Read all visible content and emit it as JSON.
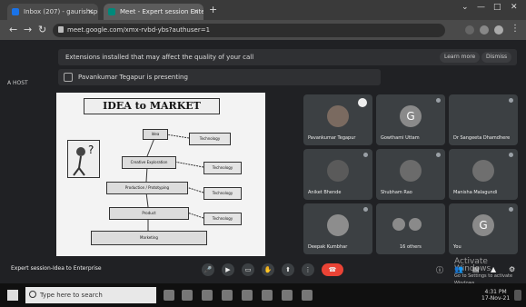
{
  "browser": {
    "tabs": [
      {
        "label": "Inbox (207) - gaurishsp@gmail.com"
      },
      {
        "label": "Meet - Expert session Enter"
      }
    ],
    "url": "meet.google.com/xmx-rvbd-ybs?authuser=1"
  },
  "meet": {
    "notice": "Extensions installed that may affect the quality of your call",
    "notice_learn_more": "Learn more",
    "notice_dismiss": "Dismiss",
    "host_label": "A HOST",
    "presenting_text": "Pavankumar Tegapur is presenting",
    "slide": {
      "title": "IDEA to MARKET",
      "idea": "Idea",
      "creative": "Creative Exploration",
      "production": "Production / Prototyping",
      "product": "Product",
      "marketing": "Marketing",
      "technology": "Technology"
    },
    "participants": [
      {
        "name": "Pavankumar Tegapur",
        "initial": ""
      },
      {
        "name": "Gowthami Uttam",
        "initial": "G"
      },
      {
        "name": "Dr Sangeeta Dhamdhere",
        "initial": ""
      },
      {
        "name": "Aniket Bhende",
        "initial": ""
      },
      {
        "name": "Shubham Rao",
        "initial": ""
      },
      {
        "name": "Manisha Malagundi",
        "initial": ""
      },
      {
        "name": "Deepak Kumbhar",
        "initial": ""
      },
      {
        "name": "16 others",
        "initial": ""
      },
      {
        "name": "You",
        "initial": "G"
      }
    ],
    "caption": "Expert session-Idea to Enterprise",
    "activate_windows": "Activate Windows",
    "activate_sub": "Go to Settings to activate Windows."
  },
  "taskbar": {
    "search_placeholder": "Type here to search",
    "time": "4:31 PM",
    "date": "17-Nov-21"
  },
  "colors": {
    "meet_bg": "#202124",
    "end_call": "#ea4335",
    "tile_bg": "#3c4043"
  }
}
